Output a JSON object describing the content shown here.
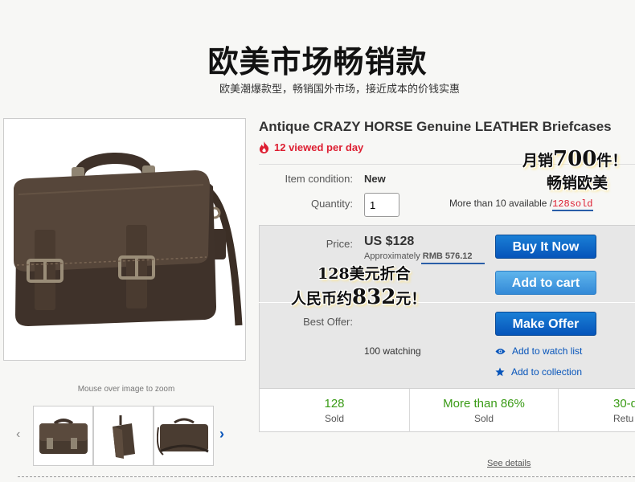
{
  "banner": {
    "title": "欧美市场畅销款",
    "subtitle": "欧美潮爆款型，畅销国外市场，接近成本的价钱实惠"
  },
  "gallery": {
    "zoom_hint": "Mouse over image to zoom"
  },
  "listing": {
    "title": "Antique CRAZY HORSE Genuine LEATHER Briefcases",
    "viewed": "12 viewed per day",
    "condition_label": "Item condition:",
    "condition_value": "New",
    "quantity_label": "Quantity:",
    "quantity_value": "1",
    "availability": "More than 10 available /",
    "sold_text": "128sold",
    "price_label": "Price:",
    "price": "US $128",
    "approx_label": "Approximately",
    "approx_value": "RMB 576.12",
    "best_offer_label": "Best Offer:",
    "watching": "100 watching",
    "see_details": "See details"
  },
  "buttons": {
    "buy_now": "Buy It Now",
    "add_to_cart": "Add to cart",
    "make_offer": "Make Offer"
  },
  "links": {
    "watch_list": "Add to watch list",
    "collection": "Add to collection"
  },
  "stats": [
    {
      "value": "128",
      "label": "Sold"
    },
    {
      "value": "More than 86%",
      "label": "Sold"
    },
    {
      "value": "30-d",
      "label": "Retu"
    }
  ],
  "promo": {
    "line1_pre": "月销",
    "line1_num": "700",
    "line1_post": "件！",
    "line2": "畅销欧美",
    "line3": "128美元折合",
    "line4_pre": "人民币约",
    "line4_num": "832",
    "line4_post": "元！"
  },
  "colors": {
    "accent_red": "#dd1e31",
    "button_blue": "#0654ba",
    "cart_blue": "#3389d7",
    "stat_green": "#3a9b16",
    "leather": "#4a3a2e"
  },
  "icons": [
    "flame-icon",
    "eye-icon",
    "star-icon",
    "chevron-left-icon",
    "chevron-right-icon"
  ]
}
